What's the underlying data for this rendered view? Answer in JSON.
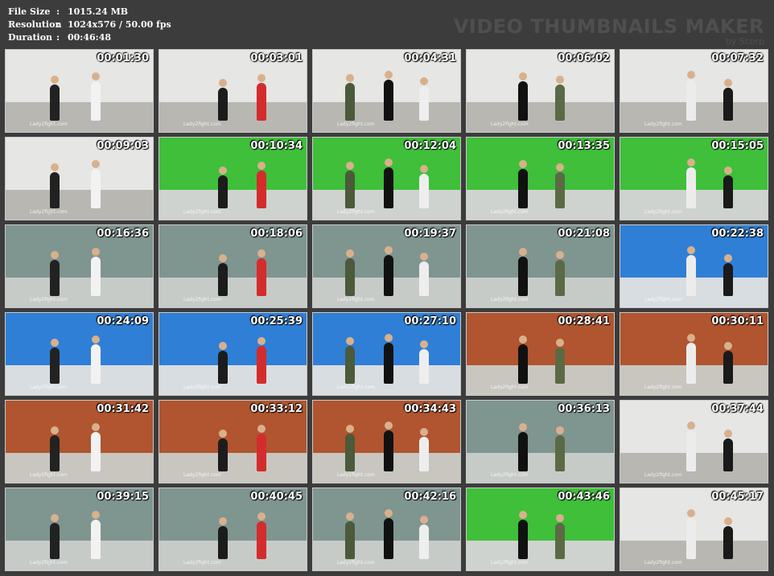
{
  "info": [
    {
      "label": "File Size",
      "sep": ":",
      "value": "1015.24 MB"
    },
    {
      "label": "Resolution",
      "sep": ":",
      "value": "1024x576 / 50.00 fps"
    },
    {
      "label": "Duration",
      "sep": ":",
      "value": "00:46:48"
    }
  ],
  "brand": {
    "title": "VIDEO THUMBNAILS MAKER",
    "by": "by Scorp"
  },
  "watermark": "Lady2fight.com",
  "thumbnails": [
    {
      "time": "00:01:30",
      "scene": "white-office"
    },
    {
      "time": "00:03:01",
      "scene": "white-office"
    },
    {
      "time": "00:04:31",
      "scene": "white-office"
    },
    {
      "time": "00:06:02",
      "scene": "white-office"
    },
    {
      "time": "00:07:32",
      "scene": "white-office"
    },
    {
      "time": "00:09:03",
      "scene": "white-office"
    },
    {
      "time": "00:10:34",
      "scene": "green-screen"
    },
    {
      "time": "00:12:04",
      "scene": "green-screen"
    },
    {
      "time": "00:13:35",
      "scene": "green-screen"
    },
    {
      "time": "00:15:05",
      "scene": "green-screen"
    },
    {
      "time": "00:16:36",
      "scene": "grey-room"
    },
    {
      "time": "00:18:06",
      "scene": "grey-room"
    },
    {
      "time": "00:19:37",
      "scene": "grey-room"
    },
    {
      "time": "00:21:08",
      "scene": "grey-room"
    },
    {
      "time": "00:22:38",
      "scene": "blue-room"
    },
    {
      "time": "00:24:09",
      "scene": "blue-room"
    },
    {
      "time": "00:25:39",
      "scene": "blue-room"
    },
    {
      "time": "00:27:10",
      "scene": "blue-room"
    },
    {
      "time": "00:28:41",
      "scene": "orange-room"
    },
    {
      "time": "00:30:11",
      "scene": "orange-room"
    },
    {
      "time": "00:31:42",
      "scene": "orange-room"
    },
    {
      "time": "00:33:12",
      "scene": "orange-room"
    },
    {
      "time": "00:34:43",
      "scene": "orange-room"
    },
    {
      "time": "00:36:13",
      "scene": "grey-room"
    },
    {
      "time": "00:37:44",
      "scene": "white-office"
    },
    {
      "time": "00:39:15",
      "scene": "grey-room"
    },
    {
      "time": "00:40:45",
      "scene": "grey-room"
    },
    {
      "time": "00:42:16",
      "scene": "grey-room"
    },
    {
      "time": "00:43:46",
      "scene": "green-screen"
    },
    {
      "time": "00:45:17",
      "scene": "white-office"
    }
  ],
  "colors": {
    "background": "#3c3c3c",
    "info_text": "#ffffff",
    "brand_text": "#4f4f4f",
    "scenes": {
      "white-office": {
        "wall": "#e6e6e4",
        "floor": "#b9b7b2"
      },
      "green-screen": {
        "wall": "#3fbf3a",
        "floor": "#cfd3cf"
      },
      "grey-room": {
        "wall": "#7f9590",
        "floor": "#c7cbc8"
      },
      "blue-room": {
        "wall": "#2f7fd6",
        "floor": "#d8dde2"
      },
      "orange-room": {
        "wall": "#b0552f",
        "floor": "#c9c6c0"
      }
    }
  }
}
